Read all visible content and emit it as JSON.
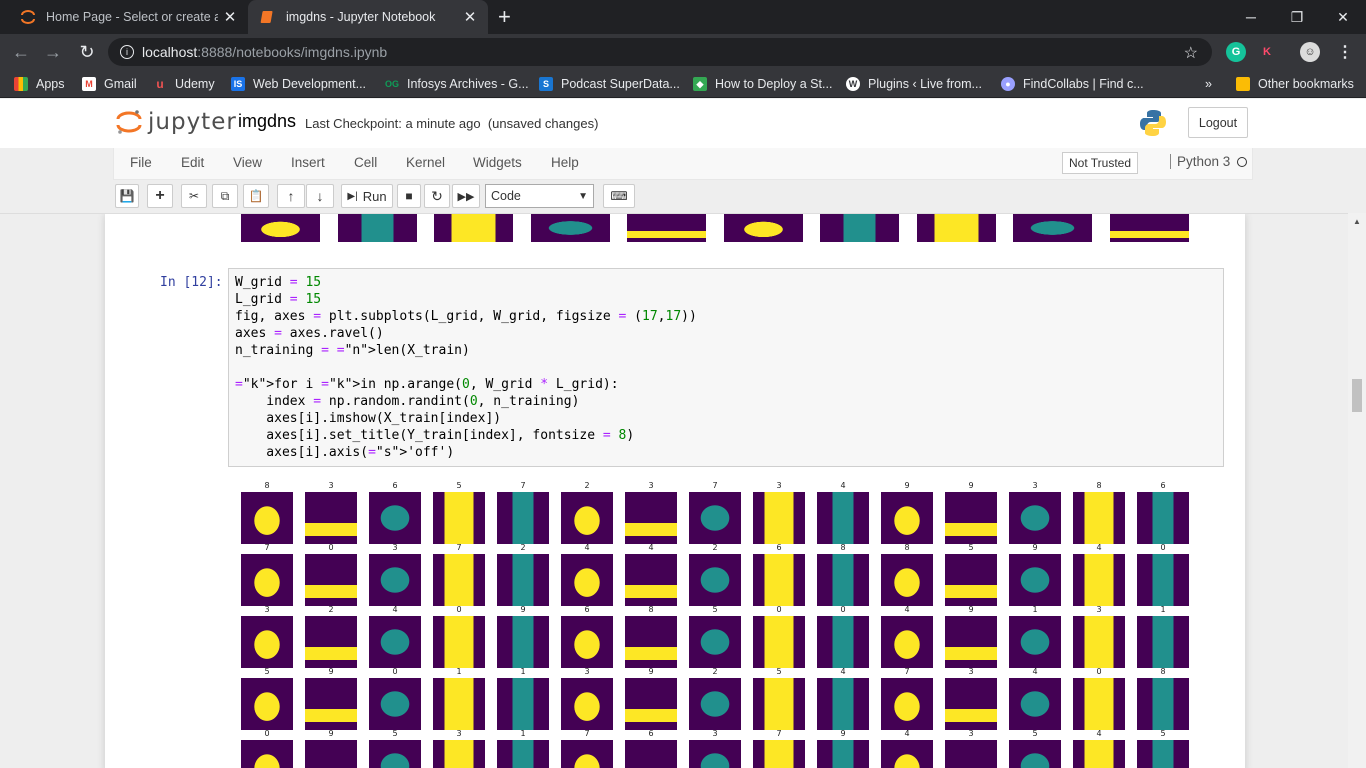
{
  "browser": {
    "tabs": [
      {
        "title": "Home Page - Select or create a n",
        "active": false
      },
      {
        "title": "imgdns - Jupyter Notebook",
        "active": true
      }
    ],
    "url_host": "localhost",
    "url_rest": ":8888/notebooks/imgdns.ipynb",
    "bookmarks": [
      {
        "label": "Apps",
        "icon": "apps-grid-icon",
        "color": "#ea4335"
      },
      {
        "label": "Gmail",
        "icon": "gmail-icon",
        "color": "#ea4335"
      },
      {
        "label": "Udemy",
        "icon": "udemy-icon",
        "color": "#ec5252"
      },
      {
        "label": "Web Development...",
        "icon": "web-dev-icon",
        "color": "#1a73e8"
      },
      {
        "label": "Infosys Archives - G...",
        "icon": "infosys-icon",
        "color": "#0f9d58"
      },
      {
        "label": "Podcast SuperData...",
        "icon": "podcast-icon",
        "color": "#1976d2"
      },
      {
        "label": "How to Deploy a St...",
        "icon": "deploy-icon",
        "color": "#34a853"
      },
      {
        "label": "Plugins ‹ Live from...",
        "icon": "wordpress-icon",
        "color": "#ffffff"
      },
      {
        "label": "FindCollabs | Find c...",
        "icon": "alien-icon",
        "color": "#9aa0ff"
      }
    ],
    "other_bookmarks": "Other bookmarks",
    "more_bookmarks": "»"
  },
  "jupyter": {
    "logo_text": "jupyter",
    "notebook_name": "imgdns",
    "checkpoint": "Last Checkpoint: a minute ago",
    "unsaved": "(unsaved changes)",
    "logout": "Logout",
    "menu": [
      "File",
      "Edit",
      "View",
      "Insert",
      "Cell",
      "Kernel",
      "Widgets",
      "Help"
    ],
    "not_trusted": "Not Trusted",
    "kernel_name": "Python 3",
    "toolbar": {
      "run_label": "Run",
      "cell_type": "Code"
    }
  },
  "cell": {
    "prompt": "In [12]:",
    "code_lines": [
      "W_grid = 15",
      "L_grid = 15",
      "fig, axes = plt.subplots(L_grid, W_grid, figsize = (17,17))",
      "axes = axes.ravel()",
      "n_training = len(X_train)",
      "",
      "for i in np.arange(0, W_grid * L_grid):",
      "    index = np.random.randint(0, n_training)",
      "    axes[i].imshow(X_train[index])",
      "    axes[i].set_title(Y_train[index], fontsize = 8)",
      "    axes[i].axis('off')"
    ]
  },
  "output_grid": {
    "row_labels": [
      [
        "8",
        "3",
        "6",
        "5",
        "7",
        "2",
        "3",
        "7",
        "3",
        "4",
        "9",
        "9",
        "3",
        "8",
        "6"
      ],
      [
        "7",
        "0",
        "3",
        "7",
        "2",
        "4",
        "4",
        "2",
        "6",
        "8",
        "8",
        "5",
        "9",
        "4",
        "0"
      ],
      [
        "3",
        "2",
        "4",
        "0",
        "9",
        "6",
        "8",
        "5",
        "0",
        "0",
        "4",
        "9",
        "1",
        "3",
        "1"
      ],
      [
        "5",
        "9",
        "0",
        "1",
        "1",
        "3",
        "9",
        "2",
        "5",
        "4",
        "7",
        "3",
        "4",
        "0",
        "8"
      ],
      [
        "0",
        "9",
        "5",
        "3",
        "1",
        "7",
        "6",
        "3",
        "7",
        "9",
        "4",
        "3",
        "5",
        "4",
        "5"
      ]
    ]
  },
  "colors": {
    "viridis_bg": "#440154",
    "viridis_mid": "#21908d",
    "viridis_high": "#fde725",
    "jupyter_orange": "#f37626",
    "prompt_blue": "#303f9f"
  }
}
